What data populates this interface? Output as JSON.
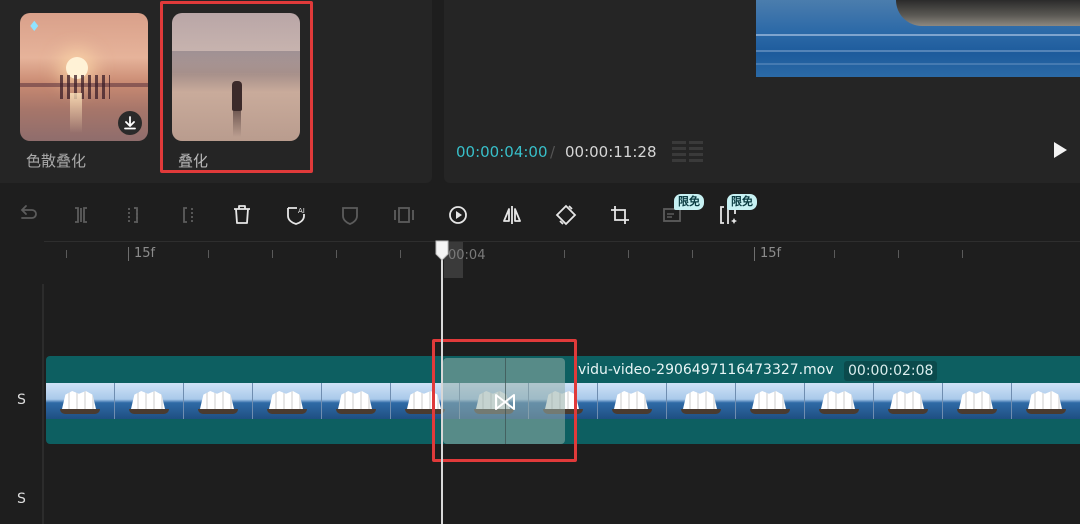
{
  "effects_panel": {
    "items": [
      {
        "label": "色散叠化",
        "badge_icon": "gem-icon",
        "action_icon": "download-icon"
      },
      {
        "label": "叠化",
        "selected": true
      }
    ]
  },
  "player": {
    "current_time": "00:00:04:00",
    "separator": "/",
    "total_time": "00:00:11:28"
  },
  "toolbar": {
    "tools": [
      "undo-icon",
      "split-icon",
      "split-left-icon",
      "split-right-icon",
      "delete-icon",
      "ai-mask-icon",
      "mask-icon",
      "freeze-icon",
      "reverse-icon",
      "mirror-icon",
      "rotate-icon",
      "crop-icon",
      "auto-caption-icon",
      "smart-split-icon"
    ],
    "badge_free": "限免",
    "accent_color": "#c7f1f3"
  },
  "timeline": {
    "ruler": {
      "label_left": "15f",
      "label_playhead": "00:04",
      "label_right": "15f"
    },
    "tracks": [
      {
        "label": "S"
      },
      {
        "label": "S"
      }
    ],
    "clip": {
      "name": "vidu-video-2906497116473327.mov",
      "duration": "00:00:02:08",
      "color": "#0d5f61"
    },
    "transition": {
      "icon": "transition-icon"
    }
  },
  "highlight_color": "#e03a3a",
  "time_color": "#38bfc9"
}
